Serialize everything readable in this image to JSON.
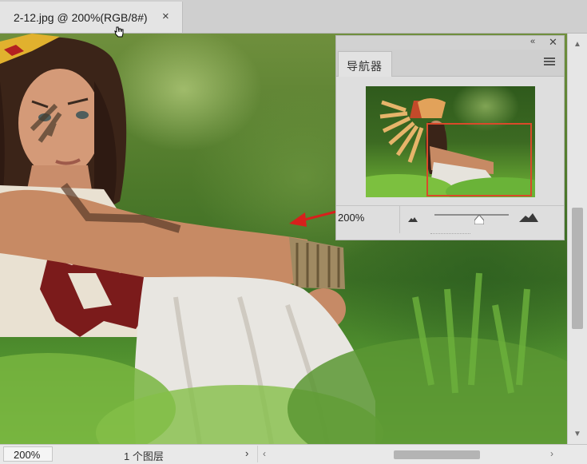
{
  "document": {
    "tab_title": "2-12.jpg @ 200%(RGB/8#)",
    "close_glyph": "×"
  },
  "icons": {
    "tab_close": "close-icon",
    "cursor": "hand-cursor-icon",
    "collapse": "double-chevron-left-icon",
    "panel_close": "close-icon",
    "panel_menu": "hamburger-menu-icon",
    "zoom_out": "small-mountain-icon",
    "zoom_in": "large-mountain-icon"
  },
  "navigator": {
    "tab_label": "导航器",
    "collapse_glyph": "«",
    "close_glyph": "✕",
    "zoom": "200%",
    "slider_level": 0.6,
    "viewbox_color": "#d94a2a"
  },
  "status": {
    "zoom": "200%",
    "layers": "1 个图层",
    "arrow": "›"
  },
  "scrollbars": {
    "up": "▲",
    "down": "▼",
    "left": "‹",
    "right": "›"
  },
  "annotation": {
    "arrow_color": "#d7201c"
  }
}
